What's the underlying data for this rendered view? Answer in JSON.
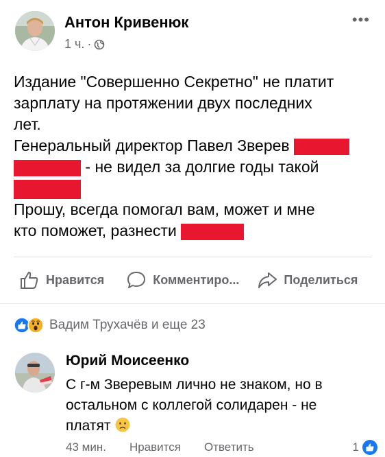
{
  "post": {
    "author": "Антон Кривенюк",
    "time": "1 ч.",
    "meta_separator": "·",
    "privacy_icon": "globe-icon",
    "more_icon": "more-dots-icon",
    "more_label": "•••",
    "lines": {
      "l1": "Издание \"Совершенно Секретно\" не платит",
      "l2": "зарплату на протяжении двух последних",
      "l3": "лет.",
      "l4": "Генеральный директор Павел Зверев",
      "l5": " - не видел за долгие годы такой",
      "l6": "Прошу, всегда помогал вам, может и мне",
      "l7": "кто поможет, разнести"
    },
    "redaction_color": "#e8162e"
  },
  "actions": {
    "like": "Нравится",
    "comment": "Комментиро...",
    "share": "Поделиться"
  },
  "reactions": {
    "text": "Вадим Трухачёв и еще 23",
    "icons": [
      "like-reaction-icon",
      "wow-reaction-icon"
    ]
  },
  "comment": {
    "author": "Юрий Моисеенко",
    "line1": "С г-м Зверевым лично не знаком, но в",
    "line2": "остальном с коллегой солидарен - не",
    "line3": "платят",
    "emoji": "disappointed-face-icon",
    "time": "43 мин.",
    "like": "Нравится",
    "reply": "Ответить",
    "like_count": "1"
  },
  "colors": {
    "accent": "#1877f2",
    "secondary_text": "#65676b",
    "text": "#050505"
  }
}
